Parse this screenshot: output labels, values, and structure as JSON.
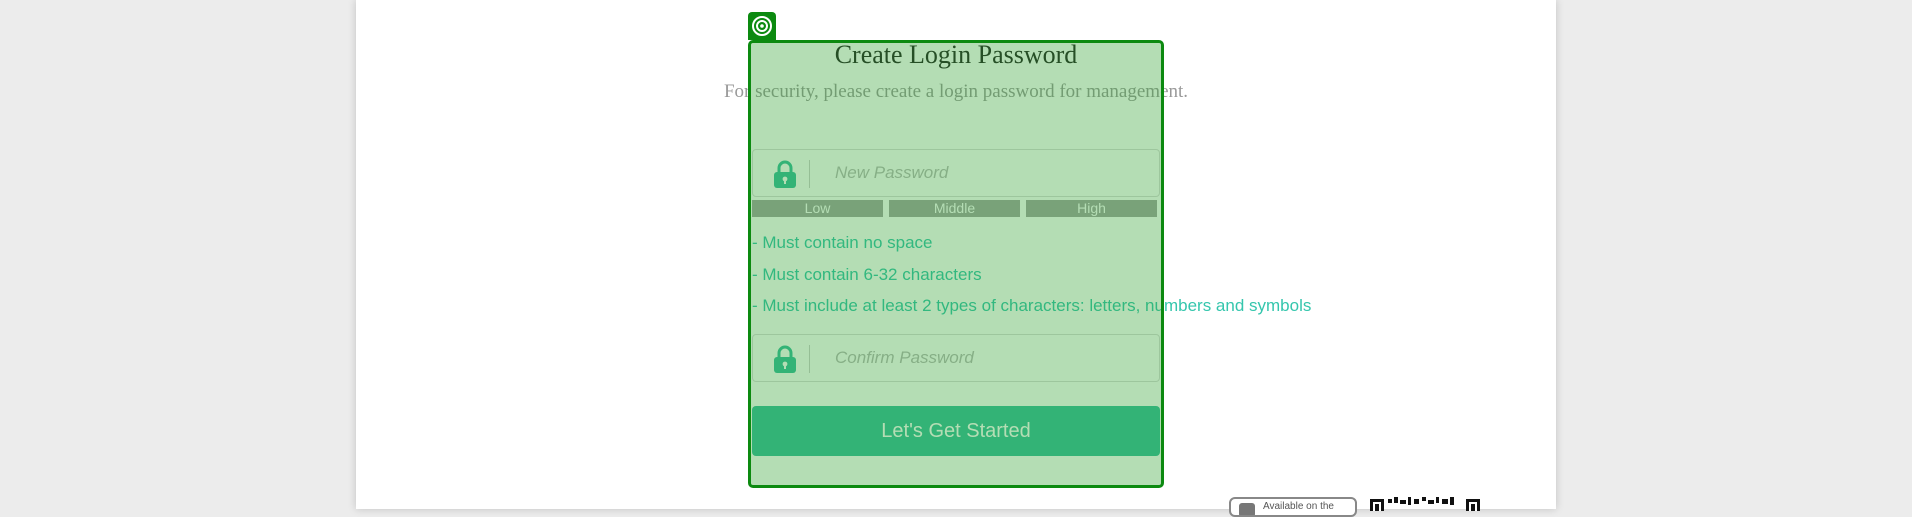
{
  "header": {
    "title": "Create Login Password",
    "subtitle": "For security, please create a login password for management."
  },
  "form": {
    "new_password_placeholder": "New Password",
    "confirm_password_placeholder": "Confirm Password",
    "strength_levels": [
      "Low",
      "Middle",
      "High"
    ],
    "rules": [
      "- Must contain no space",
      "- Must contain 6-32 characters",
      "- Must include at least 2 types of characters: letters, numbers and symbols"
    ],
    "submit_label": "Let's Get Started"
  },
  "footer": {
    "store_badge_text": "Available on the"
  },
  "icons": {
    "lock": "lock-icon",
    "overlay_tag": "target-icon",
    "qr": "qr-code-icon"
  },
  "colors": {
    "accent": "#36bd9e",
    "rule_text": "#35c6ad",
    "strength_bar": "#a3a3a3",
    "overlay_border": "#0c8a10"
  }
}
